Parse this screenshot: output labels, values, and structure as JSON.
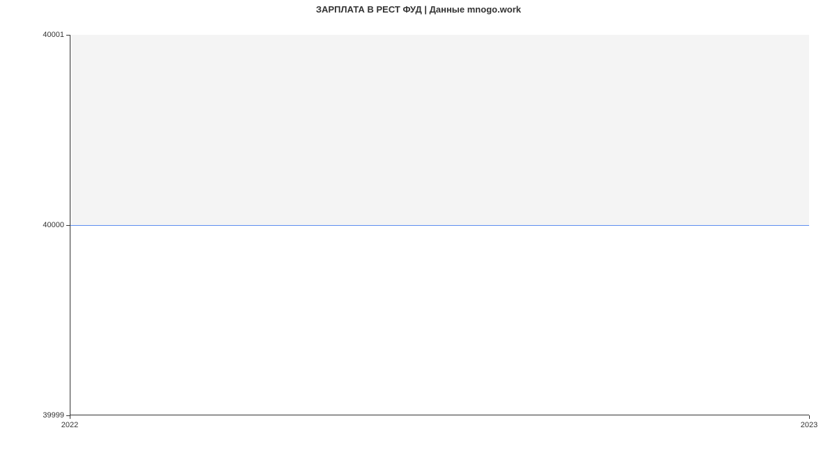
{
  "chart_data": {
    "type": "line",
    "title": "ЗАРПЛАТА В РЕСТ ФУД | Данные mnogo.work",
    "x": [
      "2022",
      "2023"
    ],
    "values": [
      40000,
      40000
    ],
    "xlabel": "",
    "ylabel": "",
    "xlim": [
      "2022",
      "2023"
    ],
    "ylim": [
      39999,
      40001
    ],
    "xticks": [
      "2022",
      "2023"
    ],
    "yticks": [
      39999,
      40000,
      40001
    ],
    "line_color": "#5b8def",
    "shade_color": "#f4f4f4"
  }
}
